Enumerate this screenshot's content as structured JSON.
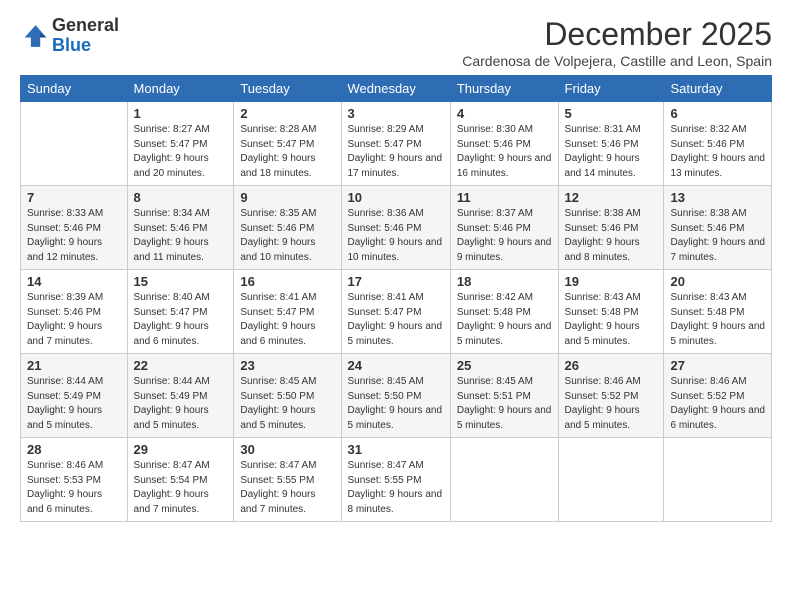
{
  "logo": {
    "general": "General",
    "blue": "Blue"
  },
  "header": {
    "month_title": "December 2025",
    "subtitle": "Cardenosa de Volpejera, Castille and Leon, Spain"
  },
  "days_of_week": [
    "Sunday",
    "Monday",
    "Tuesday",
    "Wednesday",
    "Thursday",
    "Friday",
    "Saturday"
  ],
  "weeks": [
    [
      {
        "day": "",
        "info": ""
      },
      {
        "day": "1",
        "info": "Sunrise: 8:27 AM\nSunset: 5:47 PM\nDaylight: 9 hours\nand 20 minutes."
      },
      {
        "day": "2",
        "info": "Sunrise: 8:28 AM\nSunset: 5:47 PM\nDaylight: 9 hours\nand 18 minutes."
      },
      {
        "day": "3",
        "info": "Sunrise: 8:29 AM\nSunset: 5:47 PM\nDaylight: 9 hours\nand 17 minutes."
      },
      {
        "day": "4",
        "info": "Sunrise: 8:30 AM\nSunset: 5:46 PM\nDaylight: 9 hours\nand 16 minutes."
      },
      {
        "day": "5",
        "info": "Sunrise: 8:31 AM\nSunset: 5:46 PM\nDaylight: 9 hours\nand 14 minutes."
      },
      {
        "day": "6",
        "info": "Sunrise: 8:32 AM\nSunset: 5:46 PM\nDaylight: 9 hours\nand 13 minutes."
      }
    ],
    [
      {
        "day": "7",
        "info": "Sunrise: 8:33 AM\nSunset: 5:46 PM\nDaylight: 9 hours\nand 12 minutes."
      },
      {
        "day": "8",
        "info": "Sunrise: 8:34 AM\nSunset: 5:46 PM\nDaylight: 9 hours\nand 11 minutes."
      },
      {
        "day": "9",
        "info": "Sunrise: 8:35 AM\nSunset: 5:46 PM\nDaylight: 9 hours\nand 10 minutes."
      },
      {
        "day": "10",
        "info": "Sunrise: 8:36 AM\nSunset: 5:46 PM\nDaylight: 9 hours\nand 10 minutes."
      },
      {
        "day": "11",
        "info": "Sunrise: 8:37 AM\nSunset: 5:46 PM\nDaylight: 9 hours\nand 9 minutes."
      },
      {
        "day": "12",
        "info": "Sunrise: 8:38 AM\nSunset: 5:46 PM\nDaylight: 9 hours\nand 8 minutes."
      },
      {
        "day": "13",
        "info": "Sunrise: 8:38 AM\nSunset: 5:46 PM\nDaylight: 9 hours\nand 7 minutes."
      }
    ],
    [
      {
        "day": "14",
        "info": "Sunrise: 8:39 AM\nSunset: 5:46 PM\nDaylight: 9 hours\nand 7 minutes."
      },
      {
        "day": "15",
        "info": "Sunrise: 8:40 AM\nSunset: 5:47 PM\nDaylight: 9 hours\nand 6 minutes."
      },
      {
        "day": "16",
        "info": "Sunrise: 8:41 AM\nSunset: 5:47 PM\nDaylight: 9 hours\nand 6 minutes."
      },
      {
        "day": "17",
        "info": "Sunrise: 8:41 AM\nSunset: 5:47 PM\nDaylight: 9 hours\nand 5 minutes."
      },
      {
        "day": "18",
        "info": "Sunrise: 8:42 AM\nSunset: 5:48 PM\nDaylight: 9 hours\nand 5 minutes."
      },
      {
        "day": "19",
        "info": "Sunrise: 8:43 AM\nSunset: 5:48 PM\nDaylight: 9 hours\nand 5 minutes."
      },
      {
        "day": "20",
        "info": "Sunrise: 8:43 AM\nSunset: 5:48 PM\nDaylight: 9 hours\nand 5 minutes."
      }
    ],
    [
      {
        "day": "21",
        "info": "Sunrise: 8:44 AM\nSunset: 5:49 PM\nDaylight: 9 hours\nand 5 minutes."
      },
      {
        "day": "22",
        "info": "Sunrise: 8:44 AM\nSunset: 5:49 PM\nDaylight: 9 hours\nand 5 minutes."
      },
      {
        "day": "23",
        "info": "Sunrise: 8:45 AM\nSunset: 5:50 PM\nDaylight: 9 hours\nand 5 minutes."
      },
      {
        "day": "24",
        "info": "Sunrise: 8:45 AM\nSunset: 5:50 PM\nDaylight: 9 hours\nand 5 minutes."
      },
      {
        "day": "25",
        "info": "Sunrise: 8:45 AM\nSunset: 5:51 PM\nDaylight: 9 hours\nand 5 minutes."
      },
      {
        "day": "26",
        "info": "Sunrise: 8:46 AM\nSunset: 5:52 PM\nDaylight: 9 hours\nand 5 minutes."
      },
      {
        "day": "27",
        "info": "Sunrise: 8:46 AM\nSunset: 5:52 PM\nDaylight: 9 hours\nand 6 minutes."
      }
    ],
    [
      {
        "day": "28",
        "info": "Sunrise: 8:46 AM\nSunset: 5:53 PM\nDaylight: 9 hours\nand 6 minutes."
      },
      {
        "day": "29",
        "info": "Sunrise: 8:47 AM\nSunset: 5:54 PM\nDaylight: 9 hours\nand 7 minutes."
      },
      {
        "day": "30",
        "info": "Sunrise: 8:47 AM\nSunset: 5:55 PM\nDaylight: 9 hours\nand 7 minutes."
      },
      {
        "day": "31",
        "info": "Sunrise: 8:47 AM\nSunset: 5:55 PM\nDaylight: 9 hours\nand 8 minutes."
      },
      {
        "day": "",
        "info": ""
      },
      {
        "day": "",
        "info": ""
      },
      {
        "day": "",
        "info": ""
      }
    ]
  ]
}
